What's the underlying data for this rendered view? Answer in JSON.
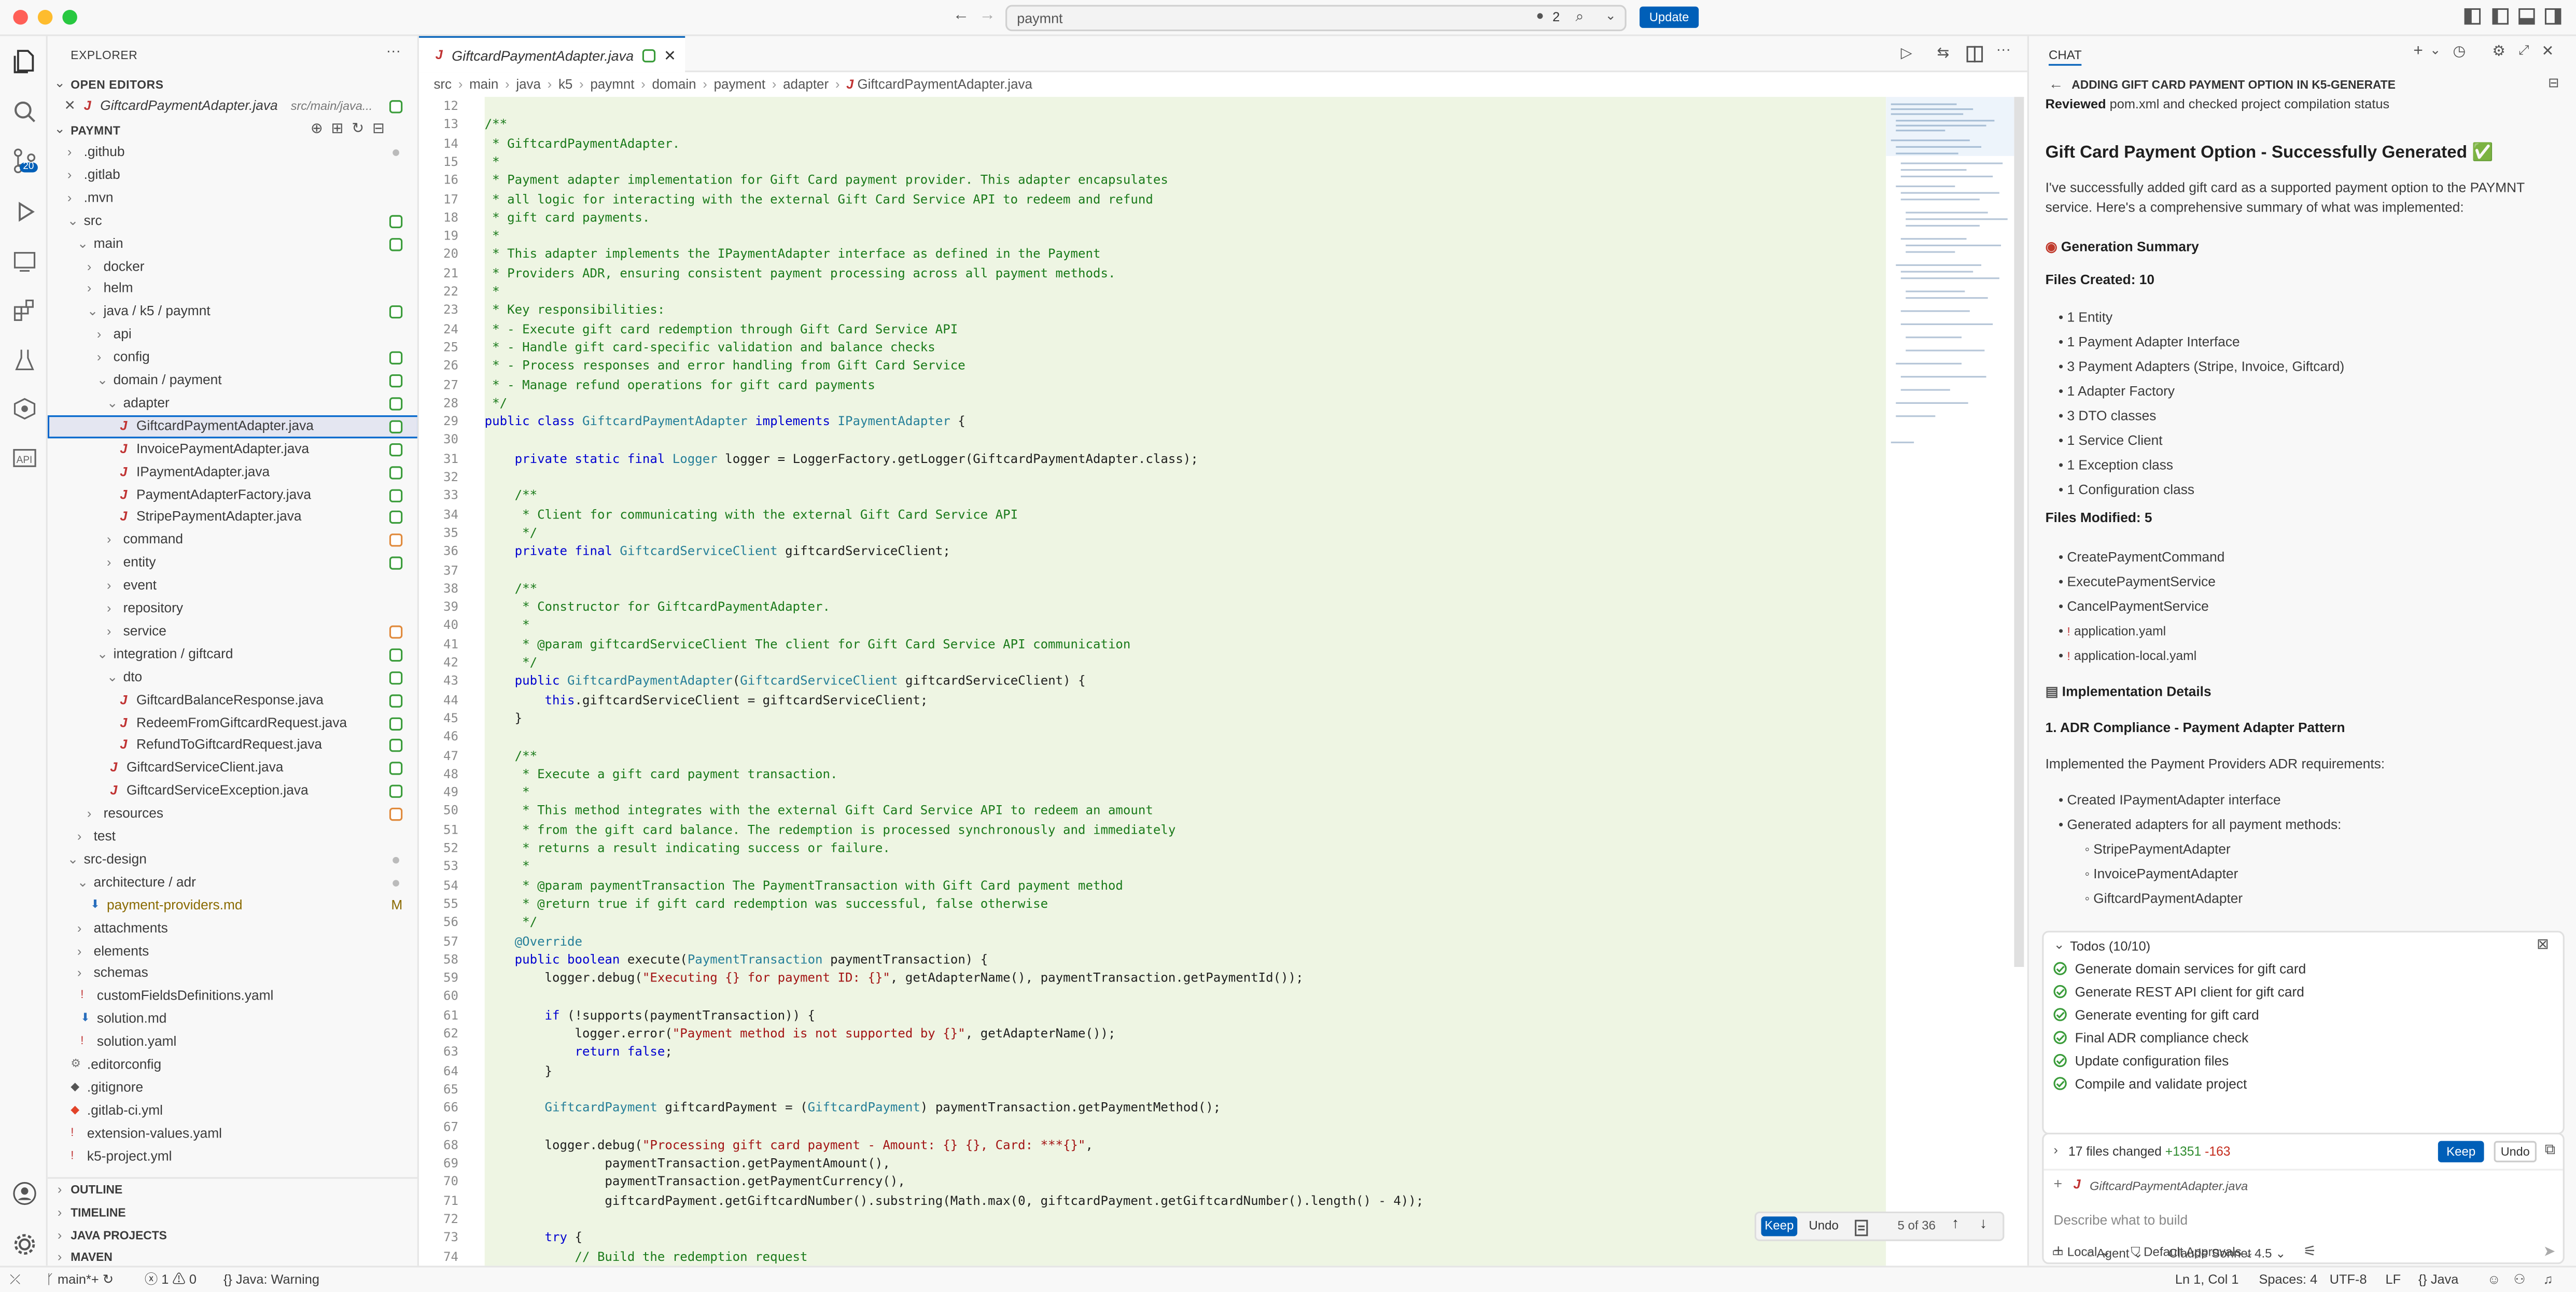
{
  "titlebar": {
    "search_text": "paymnt",
    "badge_count": "2",
    "update_label": "Update"
  },
  "activity": {
    "scm_badge": "20"
  },
  "sidebar": {
    "title": "EXPLORER",
    "open_editors_label": "OPEN EDITORS",
    "open_editor_file": "GiftcardPaymentAdapter.java",
    "open_editor_path": "src/main/java...",
    "project_label": "PAYMNT",
    "tree": [
      {
        "label": ".github",
        "indent": 1,
        "chev": "›",
        "marker": "gray"
      },
      {
        "label": ".gitlab",
        "indent": 1,
        "chev": "›",
        "marker": ""
      },
      {
        "label": ".mvn",
        "indent": 1,
        "chev": "›",
        "marker": ""
      },
      {
        "label": "src",
        "indent": 1,
        "chev": "⌄",
        "marker": "green"
      },
      {
        "label": "main",
        "indent": 2,
        "chev": "⌄",
        "marker": "green"
      },
      {
        "label": "docker",
        "indent": 3,
        "chev": "›",
        "marker": ""
      },
      {
        "label": "helm",
        "indent": 3,
        "chev": "›",
        "marker": ""
      },
      {
        "label": "java / k5 / paymnt",
        "indent": 3,
        "chev": "⌄",
        "marker": "green"
      },
      {
        "label": "api",
        "indent": 4,
        "chev": "›",
        "marker": ""
      },
      {
        "label": "config",
        "indent": 4,
        "chev": "›",
        "marker": "green"
      },
      {
        "label": "domain / payment",
        "indent": 4,
        "chev": "⌄",
        "marker": "green"
      },
      {
        "label": "adapter",
        "indent": 5,
        "chev": "⌄",
        "marker": "green"
      },
      {
        "label": "GiftcardPaymentAdapter.java",
        "indent": 6,
        "chev": "",
        "marker": "green",
        "java": true,
        "selected": true
      },
      {
        "label": "InvoicePaymentAdapter.java",
        "indent": 6,
        "chev": "",
        "marker": "green",
        "java": true
      },
      {
        "label": "IPaymentAdapter.java",
        "indent": 6,
        "chev": "",
        "marker": "green",
        "java": true
      },
      {
        "label": "PaymentAdapterFactory.java",
        "indent": 6,
        "chev": "",
        "marker": "green",
        "java": true
      },
      {
        "label": "StripePaymentAdapter.java",
        "indent": 6,
        "chev": "",
        "marker": "green",
        "java": true
      },
      {
        "label": "command",
        "indent": 5,
        "chev": "›",
        "marker": "orange"
      },
      {
        "label": "entity",
        "indent": 5,
        "chev": "›",
        "marker": "green"
      },
      {
        "label": "event",
        "indent": 5,
        "chev": "›",
        "marker": ""
      },
      {
        "label": "repository",
        "indent": 5,
        "chev": "›",
        "marker": ""
      },
      {
        "label": "service",
        "indent": 5,
        "chev": "›",
        "marker": "orange"
      },
      {
        "label": "integration / giftcard",
        "indent": 4,
        "chev": "⌄",
        "marker": "green"
      },
      {
        "label": "dto",
        "indent": 5,
        "chev": "⌄",
        "marker": "green"
      },
      {
        "label": "GiftcardBalanceResponse.java",
        "indent": 6,
        "chev": "",
        "marker": "green",
        "java": true
      },
      {
        "label": "RedeemFromGiftcardRequest.java",
        "indent": 6,
        "chev": "",
        "marker": "green",
        "java": true
      },
      {
        "label": "RefundToGiftcardRequest.java",
        "indent": 6,
        "chev": "",
        "marker": "green",
        "java": true
      },
      {
        "label": "GiftcardServiceClient.java",
        "indent": 5,
        "chev": "",
        "marker": "green",
        "java": true
      },
      {
        "label": "GiftcardServiceException.java",
        "indent": 5,
        "chev": "",
        "marker": "green",
        "java": true
      },
      {
        "label": "resources",
        "indent": 3,
        "chev": "›",
        "marker": "orange"
      },
      {
        "label": "test",
        "indent": 2,
        "chev": "›",
        "marker": ""
      },
      {
        "label": "src-design",
        "indent": 1,
        "chev": "⌄",
        "marker": "gray"
      },
      {
        "label": "architecture / adr",
        "indent": 2,
        "chev": "⌄",
        "marker": "gray"
      },
      {
        "label": "payment-providers.md",
        "indent": 3,
        "chev": "",
        "marker": "M",
        "icon": "md"
      },
      {
        "label": "attachments",
        "indent": 2,
        "chev": "›",
        "marker": ""
      },
      {
        "label": "elements",
        "indent": 2,
        "chev": "›",
        "marker": ""
      },
      {
        "label": "schemas",
        "indent": 2,
        "chev": "›",
        "marker": ""
      },
      {
        "label": "customFieldsDefinitions.yaml",
        "indent": 2,
        "chev": "",
        "marker": "",
        "icon": "yaml"
      },
      {
        "label": "solution.md",
        "indent": 2,
        "chev": "",
        "marker": "",
        "icon": "md"
      },
      {
        "label": "solution.yaml",
        "indent": 2,
        "chev": "",
        "marker": "",
        "icon": "yaml"
      },
      {
        "label": ".editorconfig",
        "indent": 1,
        "chev": "",
        "marker": "",
        "icon": "gear"
      },
      {
        "label": ".gitignore",
        "indent": 1,
        "chev": "",
        "marker": "",
        "icon": "git"
      },
      {
        "label": ".gitlab-ci.yml",
        "indent": 1,
        "chev": "",
        "marker": "",
        "icon": "gitlab"
      },
      {
        "label": "extension-values.yaml",
        "indent": 1,
        "chev": "",
        "marker": "",
        "icon": "yaml"
      },
      {
        "label": "k5-project.yml",
        "indent": 1,
        "chev": "",
        "marker": "",
        "icon": "yaml"
      }
    ],
    "bottom_sections": [
      "OUTLINE",
      "TIMELINE",
      "JAVA PROJECTS",
      "MAVEN"
    ]
  },
  "editor": {
    "tab_label": "GiftcardPaymentAdapter.java",
    "breadcrumb": [
      "src",
      "main",
      "java",
      "k5",
      "paymnt",
      "domain",
      "payment",
      "adapter",
      "GiftcardPaymentAdapter.java"
    ],
    "first_line": 12,
    "lines": [
      [
        [
          "",
          ""
        ]
      ],
      [
        [
          "cm",
          "/**"
        ]
      ],
      [
        [
          "cm",
          " * GiftcardPaymentAdapter."
        ]
      ],
      [
        [
          "cm",
          " *"
        ]
      ],
      [
        [
          "cm",
          " * Payment adapter implementation for Gift Card payment provider. This adapter encapsulates"
        ]
      ],
      [
        [
          "cm",
          " * all logic for interacting with the external Gift Card Service API to redeem and refund"
        ]
      ],
      [
        [
          "cm",
          " * gift card payments."
        ]
      ],
      [
        [
          "cm",
          " *"
        ]
      ],
      [
        [
          "cm",
          " * This adapter implements the IPaymentAdapter interface as defined in the Payment"
        ]
      ],
      [
        [
          "cm",
          " * Providers ADR, ensuring consistent payment processing across all payment methods."
        ]
      ],
      [
        [
          "cm",
          " *"
        ]
      ],
      [
        [
          "cm",
          " * Key responsibilities:"
        ]
      ],
      [
        [
          "cm",
          " * - Execute gift card redemption through Gift Card Service API"
        ]
      ],
      [
        [
          "cm",
          " * - Handle gift card-specific validation and balance checks"
        ]
      ],
      [
        [
          "cm",
          " * - Process responses and error handling from Gift Card Service"
        ]
      ],
      [
        [
          "cm",
          " * - Manage refund operations for gift card payments"
        ]
      ],
      [
        [
          "cm",
          " */"
        ]
      ],
      [
        [
          "kw",
          "public class "
        ],
        [
          "ty",
          "GiftcardPaymentAdapter "
        ],
        [
          "kw",
          "implements "
        ],
        [
          "ty",
          "IPaymentAdapter "
        ],
        [
          "",
          "{"
        ]
      ],
      [
        [
          "",
          ""
        ]
      ],
      [
        [
          "kw",
          "    private static final "
        ],
        [
          "ty",
          "Logger "
        ],
        [
          "",
          "logger = LoggerFactory.getLogger(GiftcardPaymentAdapter.class);"
        ]
      ],
      [
        [
          "",
          ""
        ]
      ],
      [
        [
          "cm",
          "    /**"
        ]
      ],
      [
        [
          "cm",
          "     * Client for communicating with the external Gift Card Service API"
        ]
      ],
      [
        [
          "cm",
          "     */"
        ]
      ],
      [
        [
          "kw",
          "    private final "
        ],
        [
          "ty",
          "GiftcardServiceClient "
        ],
        [
          "",
          "giftcardServiceClient;"
        ]
      ],
      [
        [
          "",
          ""
        ]
      ],
      [
        [
          "cm",
          "    /**"
        ]
      ],
      [
        [
          "cm",
          "     * Constructor for GiftcardPaymentAdapter."
        ]
      ],
      [
        [
          "cm",
          "     *"
        ]
      ],
      [
        [
          "cm",
          "     * @param giftcardServiceClient The client for Gift Card Service API communication"
        ]
      ],
      [
        [
          "cm",
          "     */"
        ]
      ],
      [
        [
          "kw",
          "    public "
        ],
        [
          "ty",
          "GiftcardPaymentAdapter"
        ],
        [
          "",
          "("
        ],
        [
          "ty",
          "GiftcardServiceClient "
        ],
        [
          "",
          "giftcardServiceClient) {"
        ]
      ],
      [
        [
          "kw",
          "        this"
        ],
        [
          "",
          ".giftcardServiceClient = giftcardServiceClient;"
        ]
      ],
      [
        [
          "",
          "    }"
        ]
      ],
      [
        [
          "",
          ""
        ]
      ],
      [
        [
          "cm",
          "    /**"
        ]
      ],
      [
        [
          "cm",
          "     * Execute a gift card payment transaction."
        ]
      ],
      [
        [
          "cm",
          "     *"
        ]
      ],
      [
        [
          "cm",
          "     * This method integrates with the external Gift Card Service API to redeem an amount"
        ]
      ],
      [
        [
          "cm",
          "     * from the gift card balance. The redemption is processed synchronously and immediately"
        ]
      ],
      [
        [
          "cm",
          "     * returns a result indicating success or failure."
        ]
      ],
      [
        [
          "cm",
          "     *"
        ]
      ],
      [
        [
          "cm",
          "     * @param paymentTransaction The PaymentTransaction with Gift Card payment method"
        ]
      ],
      [
        [
          "cm",
          "     * @return true if gift card redemption was successful, false otherwise"
        ]
      ],
      [
        [
          "cm",
          "     */"
        ]
      ],
      [
        [
          "ty",
          "    @Override"
        ]
      ],
      [
        [
          "kw",
          "    public boolean "
        ],
        [
          "",
          "execute("
        ],
        [
          "ty",
          "PaymentTransaction "
        ],
        [
          "",
          "paymentTransaction) {"
        ]
      ],
      [
        [
          "",
          "        logger.debug("
        ],
        [
          "st",
          "\"Executing {} for payment ID: {}\""
        ],
        [
          "",
          ", getAdapterName(), paymentTransaction.getPaymentId());"
        ]
      ],
      [
        [
          "",
          ""
        ]
      ],
      [
        [
          "kw",
          "        if "
        ],
        [
          "",
          "(!supports(paymentTransaction)) {"
        ]
      ],
      [
        [
          "",
          "            logger.error("
        ],
        [
          "st",
          "\"Payment method is not supported by {}\""
        ],
        [
          "",
          ", getAdapterName());"
        ]
      ],
      [
        [
          "kw",
          "            return false"
        ],
        [
          "",
          ";"
        ]
      ],
      [
        [
          "",
          "        }"
        ]
      ],
      [
        [
          "",
          ""
        ]
      ],
      [
        [
          "ty",
          "        GiftcardPayment "
        ],
        [
          "",
          "giftcardPayment = ("
        ],
        [
          "ty",
          "GiftcardPayment"
        ],
        [
          "",
          ") paymentTransaction.getPaymentMethod();"
        ]
      ],
      [
        [
          "",
          ""
        ]
      ],
      [
        [
          "",
          "        logger.debug("
        ],
        [
          "st",
          "\"Processing gift card payment - Amount: {} {}, Card: ***{}\""
        ],
        [
          "",
          ","
        ]
      ],
      [
        [
          "",
          "                paymentTransaction.getPaymentAmount(),"
        ]
      ],
      [
        [
          "",
          "                paymentTransaction.getPaymentCurrency(),"
        ]
      ],
      [
        [
          "",
          "                giftcardPayment.getGiftcardNumber().substring(Math.max(0, giftcardPayment.getGiftcardNumber().length() - 4));"
        ]
      ],
      [
        [
          "",
          ""
        ]
      ],
      [
        [
          "kw",
          "        try "
        ],
        [
          "",
          "{"
        ]
      ],
      [
        [
          "cm",
          "            // Build the redemption request"
        ]
      ]
    ],
    "diff_bar": {
      "keep": "Keep",
      "undo": "Undo",
      "position": "5 of 36"
    }
  },
  "chat": {
    "header": "CHAT",
    "thread_title": "ADDING GIFT CARD PAYMENT OPTION IN K5-GENERATE",
    "reviewed_label": "Reviewed",
    "reviewed_text": "pom.xml and checked project compilation status",
    "heading": "Gift Card Payment Option - Successfully Generated ✅",
    "intro": [
      "I've successfully added gift card as a supported payment option to the PAYMNT",
      "service. Here's a comprehensive summary of what was implemented:"
    ],
    "summary_heading": "Generation Summary",
    "files_created": "Files Created: 10",
    "created_items": [
      "1 Entity",
      "1 Payment Adapter Interface",
      "3 Payment Adapters (Stripe, Invoice, Giftcard)",
      "1 Adapter Factory",
      "3 DTO classes",
      "1 Service Client",
      "1 Exception class",
      "1 Configuration class"
    ],
    "files_modified": "Files Modified: 5",
    "modified_items": [
      "CreatePaymentCommand",
      "ExecutePaymentService",
      "CancelPaymentService",
      "application.yaml",
      "application-local.yaml"
    ],
    "impl_heading": "Implementation Details",
    "adr_heading": "1. ADR Compliance - Payment Adapter Pattern",
    "adr_intro": "Implemented the Payment Providers ADR requirements:",
    "adr_items": [
      "Created IPaymentAdapter interface",
      "Generated adapters for all payment methods:"
    ],
    "adr_sub": [
      "StripePaymentAdapter",
      "InvoicePaymentAdapter",
      "GiftcardPaymentAdapter"
    ],
    "todos_title": "Todos (10/10)",
    "todos": [
      "Generate domain services for gift card",
      "Generate REST API client for gift card",
      "Generate eventing for gift card",
      "Final ADR compliance check",
      "Update configuration files",
      "Compile and validate project"
    ],
    "files_changed": "17 files changed",
    "added": "+1351",
    "removed": "-163",
    "keep": "Keep",
    "undo": "Undo",
    "attached_file": "GiftcardPaymentAdapter.java",
    "input_placeholder": "Describe what to build",
    "mode": "Agent",
    "model": "Claude Sonnet 4.5",
    "local": "Local",
    "approvals": "Default Approvals"
  },
  "status": {
    "branch": "main*+",
    "errors": "1",
    "warnings": "0",
    "java": "Java: Warning",
    "position": "Ln 1, Col 1",
    "spaces": "Spaces: 4",
    "encoding": "UTF-8",
    "eol": "LF",
    "language": "Java"
  },
  "colors": {
    "accent": "#005fb8",
    "added": "#2e8b2e",
    "removed": "#c42b1c",
    "diff_bg": "#eef5e3"
  }
}
